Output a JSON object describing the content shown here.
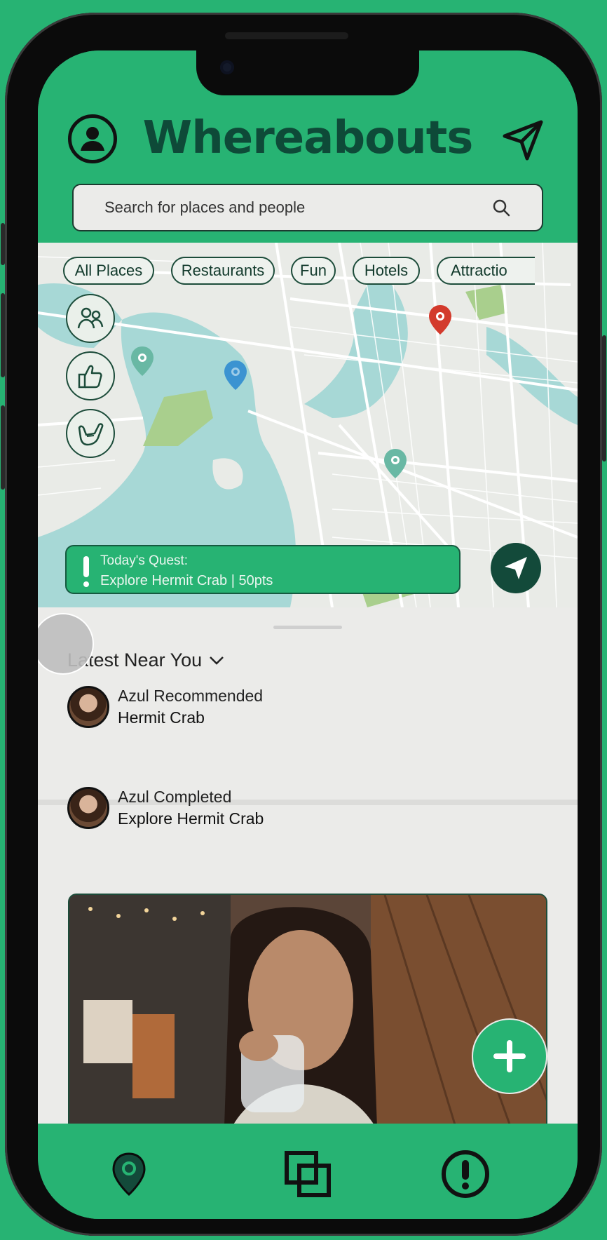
{
  "header": {
    "app_title": "Whereabouts",
    "search_placeholder": "Search for places and people"
  },
  "filters": [
    "All Places",
    "Restaurants",
    "Fun",
    "Hotels",
    "Attractio"
  ],
  "map": {
    "side_buttons": [
      "friends-icon",
      "thumbs-up-icon",
      "shaka-icon"
    ],
    "pins": [
      {
        "kind": "map-pin",
        "color": "#69b8a4"
      },
      {
        "kind": "map-pin",
        "color": "#3b93d1"
      },
      {
        "kind": "map-pin",
        "color": "#d33a2c"
      },
      {
        "kind": "map-pin",
        "color": "#69b8a4"
      }
    ],
    "quest": {
      "label": "Today's Quest:",
      "text": "Explore Hermit Crab | 50pts"
    }
  },
  "feed": {
    "section_title": "Latest Near You",
    "items": [
      {
        "action": "Azul Recommended",
        "subject": "Hermit Crab"
      },
      {
        "action": "Azul Completed",
        "subject": "Explore Hermit Crab"
      }
    ]
  },
  "tabbar": {
    "tabs": [
      "map-pin-icon",
      "feed-icon",
      "alert-icon"
    ]
  },
  "colors": {
    "brand_green": "#27b373",
    "dark_green": "#0e4a38",
    "sheet_bg": "#ebebe9"
  }
}
